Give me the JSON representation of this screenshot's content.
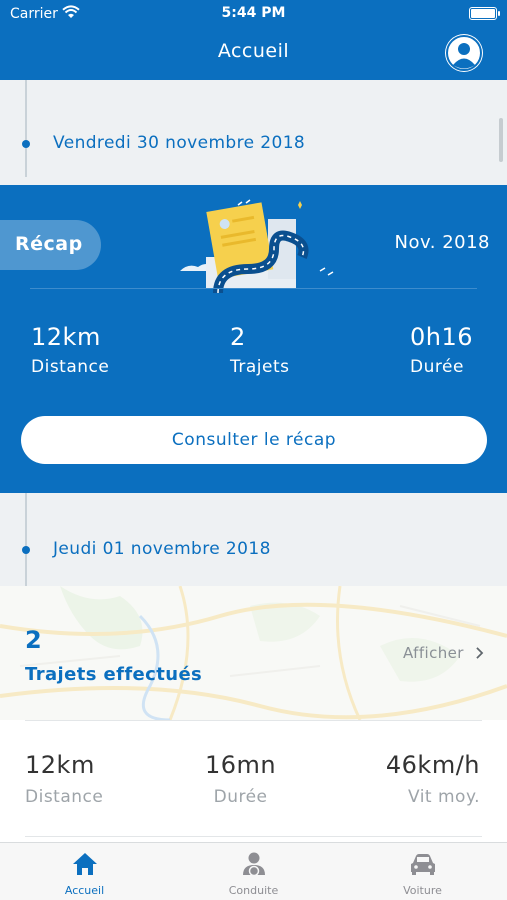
{
  "status_bar": {
    "carrier": "Carrier",
    "time": "5:44 PM"
  },
  "header": {
    "title": "Accueil"
  },
  "timeline": [
    {
      "date": "Vendredi 30 novembre 2018"
    },
    {
      "date": "Jeudi 01 novembre 2018"
    }
  ],
  "recap": {
    "badge": "Récap",
    "month": "Nov. 2018",
    "stats": [
      {
        "value": "12km",
        "label": "Distance"
      },
      {
        "value": "2",
        "label": "Trajets"
      },
      {
        "value": "0h16",
        "label": "Durée"
      }
    ],
    "button_label": "Consulter le récap"
  },
  "trips": {
    "count": "2",
    "label": "Trajets effectués",
    "action": "Afficher",
    "stats": [
      {
        "value": "12km",
        "label": "Distance"
      },
      {
        "value": "16mn",
        "label": "Durée"
      },
      {
        "value": "46km/h",
        "label": "Vit moy."
      }
    ]
  },
  "tabs": [
    {
      "label": "Accueil",
      "icon": "home-icon",
      "active": true
    },
    {
      "label": "Conduite",
      "icon": "driver-icon",
      "active": false
    },
    {
      "label": "Voiture",
      "icon": "car-icon",
      "active": false
    }
  ],
  "colors": {
    "primary": "#0b6fbf",
    "active_tab": "#0b6fbf",
    "inactive_tab": "#8e8e93"
  }
}
